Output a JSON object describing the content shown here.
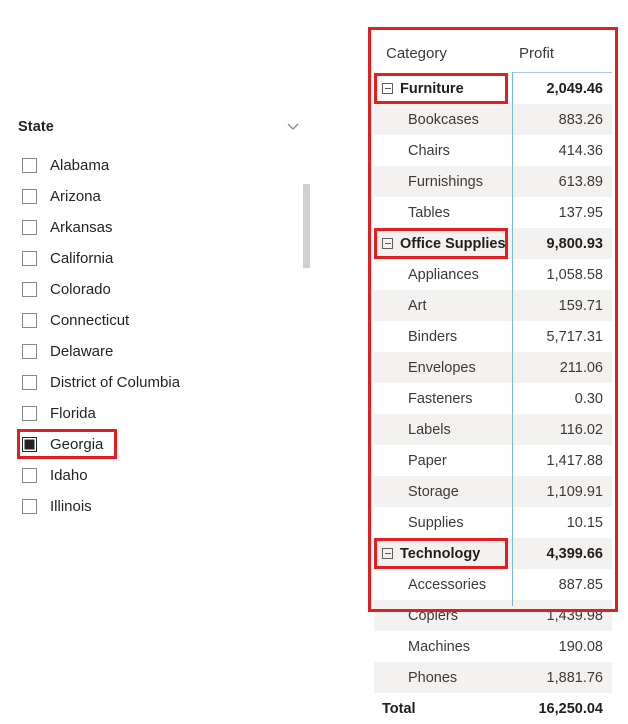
{
  "slicer": {
    "title": "State",
    "chevron_icon": "chevron-down-icon",
    "items": [
      {
        "label": "Alabama",
        "selected": false
      },
      {
        "label": "Arizona",
        "selected": false
      },
      {
        "label": "Arkansas",
        "selected": false
      },
      {
        "label": "California",
        "selected": false
      },
      {
        "label": "Colorado",
        "selected": false
      },
      {
        "label": "Connecticut",
        "selected": false
      },
      {
        "label": "Delaware",
        "selected": false
      },
      {
        "label": "District of Columbia",
        "selected": false
      },
      {
        "label": "Florida",
        "selected": false
      },
      {
        "label": "Georgia",
        "selected": true
      },
      {
        "label": "Idaho",
        "selected": false
      },
      {
        "label": "Illinois",
        "selected": false
      }
    ]
  },
  "matrix": {
    "columns": [
      "Category",
      "Profit"
    ],
    "expand_icon": "collapse-minus-icon",
    "rows": [
      {
        "label": "Furniture",
        "value": "2,049.46",
        "level": "group",
        "shaded": false,
        "annotated": true
      },
      {
        "label": "Bookcases",
        "value": "883.26",
        "level": "child",
        "shaded": true,
        "annotated": false
      },
      {
        "label": "Chairs",
        "value": "414.36",
        "level": "child",
        "shaded": false,
        "annotated": false
      },
      {
        "label": "Furnishings",
        "value": "613.89",
        "level": "child",
        "shaded": true,
        "annotated": false
      },
      {
        "label": "Tables",
        "value": "137.95",
        "level": "child",
        "shaded": false,
        "annotated": false
      },
      {
        "label": "Office Supplies",
        "value": "9,800.93",
        "level": "group",
        "shaded": true,
        "annotated": true
      },
      {
        "label": "Appliances",
        "value": "1,058.58",
        "level": "child",
        "shaded": false,
        "annotated": false
      },
      {
        "label": "Art",
        "value": "159.71",
        "level": "child",
        "shaded": true,
        "annotated": false
      },
      {
        "label": "Binders",
        "value": "5,717.31",
        "level": "child",
        "shaded": false,
        "annotated": false
      },
      {
        "label": "Envelopes",
        "value": "211.06",
        "level": "child",
        "shaded": true,
        "annotated": false
      },
      {
        "label": "Fasteners",
        "value": "0.30",
        "level": "child",
        "shaded": false,
        "annotated": false
      },
      {
        "label": "Labels",
        "value": "116.02",
        "level": "child",
        "shaded": true,
        "annotated": false
      },
      {
        "label": "Paper",
        "value": "1,417.88",
        "level": "child",
        "shaded": false,
        "annotated": false
      },
      {
        "label": "Storage",
        "value": "1,109.91",
        "level": "child",
        "shaded": true,
        "annotated": false
      },
      {
        "label": "Supplies",
        "value": "10.15",
        "level": "child",
        "shaded": false,
        "annotated": false
      },
      {
        "label": "Technology",
        "value": "4,399.66",
        "level": "group",
        "shaded": true,
        "annotated": true
      },
      {
        "label": "Accessories",
        "value": "887.85",
        "level": "child",
        "shaded": false,
        "annotated": false
      },
      {
        "label": "Copiers",
        "value": "1,439.98",
        "level": "child",
        "shaded": true,
        "annotated": false
      },
      {
        "label": "Machines",
        "value": "190.08",
        "level": "child",
        "shaded": false,
        "annotated": false
      },
      {
        "label": "Phones",
        "value": "1,881.76",
        "level": "child",
        "shaded": true,
        "annotated": false
      },
      {
        "label": "Total",
        "value": "16,250.04",
        "level": "total",
        "shaded": false,
        "annotated": false
      }
    ]
  },
  "annotation_color": "#e02020"
}
